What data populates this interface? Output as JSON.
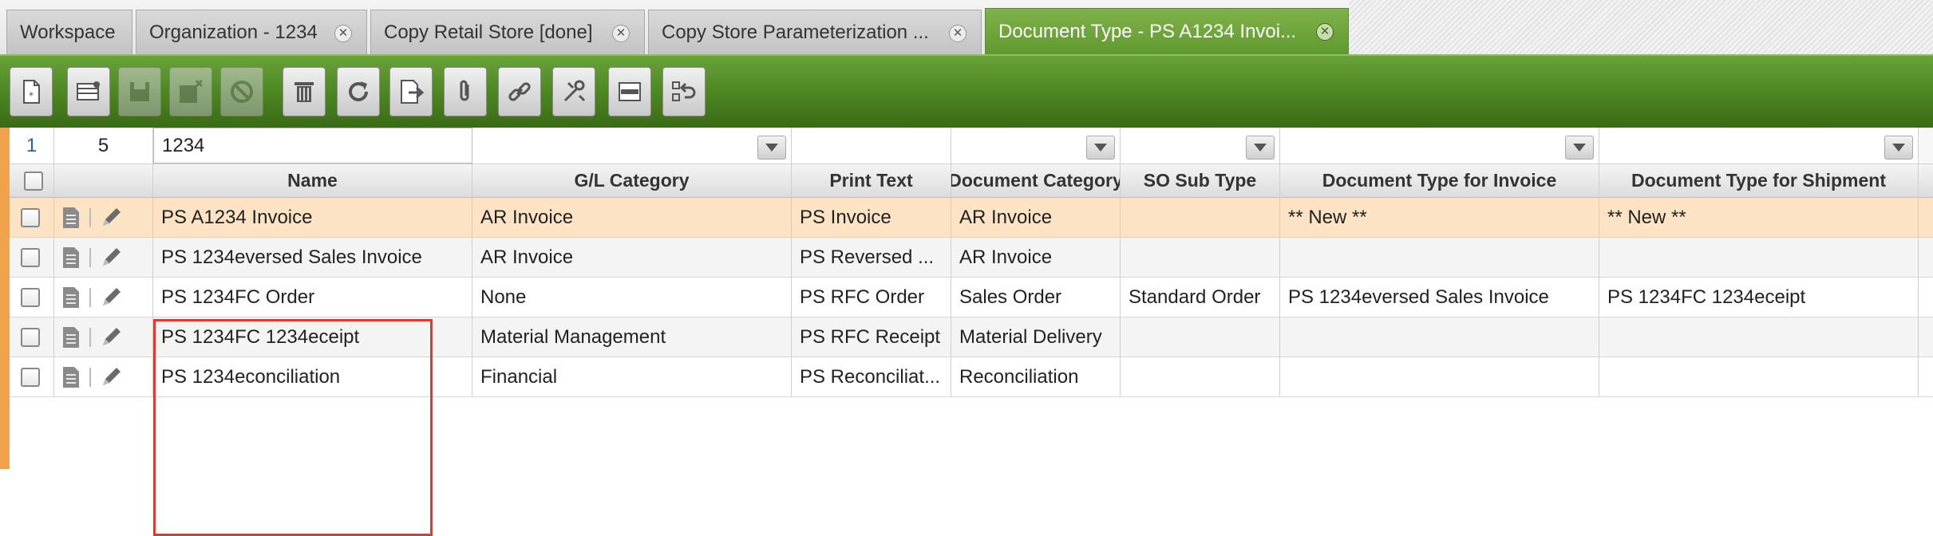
{
  "tabs": [
    {
      "label": "Workspace",
      "closable": false,
      "active": false
    },
    {
      "label": "Organization - 1234",
      "closable": true,
      "active": false
    },
    {
      "label": "Copy Retail Store [done]",
      "closable": true,
      "active": false
    },
    {
      "label": "Copy Store Parameterization ...",
      "closable": true,
      "active": false
    },
    {
      "label": "Document Type - PS A1234 Invoi...",
      "closable": true,
      "active": true
    }
  ],
  "toolbar": {
    "buttons": [
      {
        "name": "new-document-icon",
        "enabled": true
      },
      {
        "name": "new-record-grid-icon",
        "enabled": true
      },
      {
        "name": "save-icon",
        "enabled": false
      },
      {
        "name": "save-close-icon",
        "enabled": false
      },
      {
        "name": "cancel-icon",
        "enabled": false
      },
      {
        "name": "delete-icon",
        "enabled": true
      },
      {
        "name": "refresh-icon",
        "enabled": true
      },
      {
        "name": "export-icon",
        "enabled": true
      },
      {
        "name": "attachment-icon",
        "enabled": true
      },
      {
        "name": "link-icon",
        "enabled": true
      },
      {
        "name": "tools-icon",
        "enabled": true
      },
      {
        "name": "form-view-icon",
        "enabled": true
      },
      {
        "name": "undo-icon",
        "enabled": true
      }
    ]
  },
  "grid": {
    "selected_count": "1",
    "total_count": "5",
    "filter_name": "1234",
    "columns": [
      "Name",
      "G/L Category",
      "Print Text",
      "Document Category",
      "SO Sub Type",
      "Document Type for Invoice",
      "Document Type for Shipment"
    ],
    "rows": [
      {
        "name": "PS A1234 Invoice",
        "gl_category": "AR Invoice",
        "print_text": "PS Invoice",
        "doc_category": "AR Invoice",
        "so_sub_type": "",
        "doc_type_invoice": "** New **",
        "doc_type_shipment": "** New **",
        "selected": true
      },
      {
        "name": "PS 1234eversed Sales Invoice",
        "gl_category": "AR Invoice",
        "print_text": "PS Reversed ...",
        "doc_category": "AR Invoice",
        "so_sub_type": "",
        "doc_type_invoice": "",
        "doc_type_shipment": "",
        "selected": false
      },
      {
        "name": "PS 1234FC Order",
        "gl_category": "None",
        "print_text": "PS RFC Order",
        "doc_category": "Sales Order",
        "so_sub_type": "Standard Order",
        "doc_type_invoice": "PS 1234eversed Sales Invoice",
        "doc_type_shipment": "PS 1234FC 1234eceipt",
        "selected": false
      },
      {
        "name": "PS 1234FC 1234eceipt",
        "gl_category": "Material Management",
        "print_text": "PS RFC Receipt",
        "doc_category": "Material Delivery",
        "so_sub_type": "",
        "doc_type_invoice": "",
        "doc_type_shipment": "",
        "selected": false
      },
      {
        "name": "PS 1234econciliation",
        "gl_category": "Financial",
        "print_text": "PS Reconciliat...",
        "doc_category": "Reconciliation",
        "so_sub_type": "",
        "doc_type_invoice": "",
        "doc_type_shipment": "",
        "selected": false
      }
    ]
  },
  "colors": {
    "toolbar_green": "#4f8a24",
    "active_tab_green": "#6aa23a",
    "selected_row": "#fbe3c4",
    "highlight_box": "#e03a2f",
    "left_accent": "#f0a24c"
  }
}
